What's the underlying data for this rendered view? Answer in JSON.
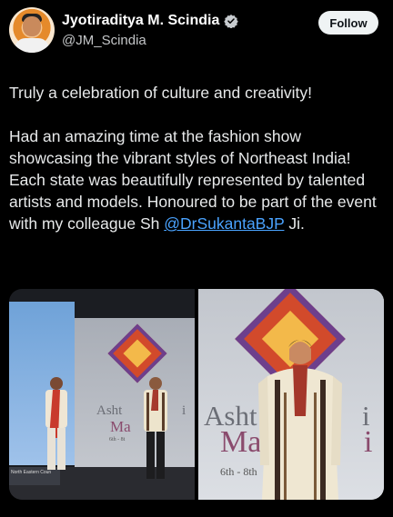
{
  "tweet": {
    "author": {
      "display_name": "Jyotiraditya M. Scindia",
      "handle": "@JM_Scindia",
      "verified": true,
      "avatar_icon": "profile-photo"
    },
    "follow_label": "Follow",
    "text": {
      "line1": "Truly a celebration of culture and creativity!",
      "para2_before": "Had an amazing time at the fashion show showcasing the vibrant styles of Northeast India! Each state was beautifully represented by talented artists and models. Honoured to be part of the event with my colleague Sh ",
      "mention": "@DrSukantaBJP",
      "para2_after": " Ji."
    },
    "media": {
      "left_photo": {
        "sign_text": "North Eastern Coun",
        "backdrop_word1": "Asht",
        "backdrop_word1b": "i",
        "backdrop_word2": "Ma",
        "backdrop_word3": "6th - 8t"
      },
      "right_photo": {
        "backdrop_word1": "Asht",
        "backdrop_word1b": "i",
        "backdrop_word2": "Ma",
        "backdrop_word2b": "i",
        "backdrop_word3": "6th - 8th"
      }
    },
    "colors": {
      "background": "#000000",
      "text": "#e7e9ea",
      "link": "#4aa3ff",
      "verified_badge": "#c7cbcf",
      "follow_button_bg": "#eff3f4"
    }
  }
}
